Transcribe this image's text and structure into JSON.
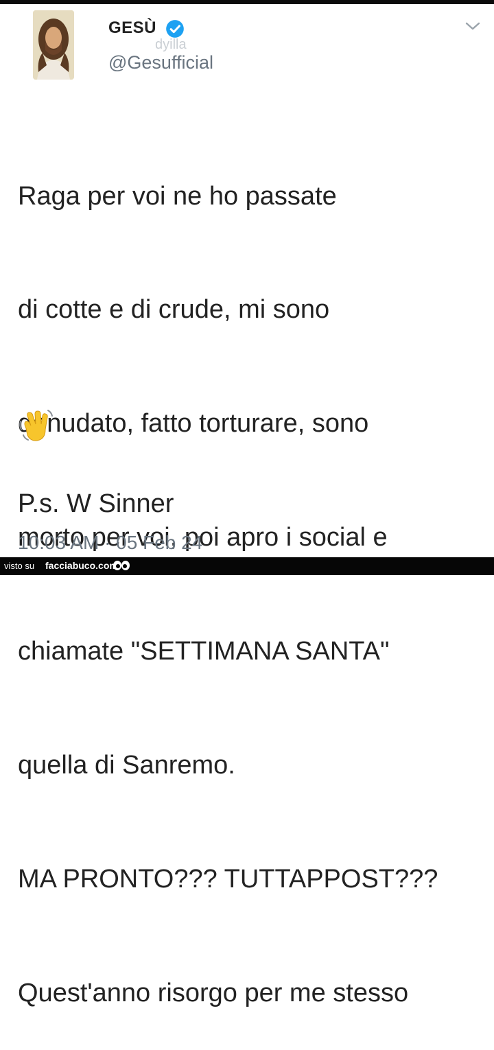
{
  "tweet": {
    "display_name": "GESÙ",
    "handle": "@Gesufficial",
    "watermark": "dyilla",
    "body_lines": [
      "Raga per voi ne ho passate",
      "di cotte e di crude, mi sono",
      "denudato, fatto torturare, sono",
      "morto per voi, poi apro i social e",
      "chiamate \"SETTIMANA SANTA\"",
      "quella di Sanremo.",
      "MA PRONTO??? TUTTAPPOST???",
      "Quest'anno risorgo per me stesso"
    ],
    "emoji_icon": "waving-hand-icon",
    "ps": "P.s. W Sinner",
    "timestamp": "10:03 AM · 05 Feb 24"
  },
  "footer": {
    "prefix": "visto su",
    "site": "facciabuco.com"
  },
  "colors": {
    "verified": "#1da1f2",
    "text": "#222222",
    "muted": "#6a7580"
  }
}
